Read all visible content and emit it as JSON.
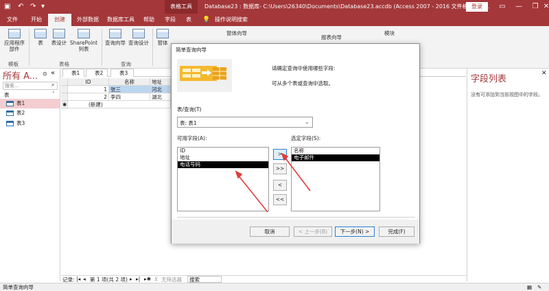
{
  "titlebar": {
    "context_tools": "表格工具",
    "doc_title": "Database23 : 数据库- C:\\Users\\26340\\Documents\\Database23.accdb (Access 2007 - 2016 文件格式) - A...",
    "login": "登录",
    "undo_icon": "undo-icon",
    "redo_icon": "redo-icon"
  },
  "tabs": [
    "文件",
    "开始",
    "创建",
    "外部数据",
    "数据库工具",
    "帮助",
    "字段",
    "表",
    "操作说明搜索"
  ],
  "ribbon": {
    "app_parts": "应用程序",
    "app_parts2": "部件",
    "table": "表",
    "table_design": "表设计",
    "sharepoint": "SharePoint",
    "sharepoint2": "列表",
    "query_wizard": "查询向导",
    "query_design": "查询设计",
    "window_abbr": "窗体",
    "form_wizard": "窗体向导",
    "report_wizard": "报表向导",
    "macro": "模块",
    "group_templates": "模板",
    "group_tables": "表格",
    "group_queries": "查询"
  },
  "nav": {
    "title": "所有 A...",
    "search_placeholder": "搜索...",
    "section": "表",
    "items": [
      "表1",
      "表2",
      "表3"
    ]
  },
  "doc_tabs": [
    "表1",
    "表2",
    "表3"
  ],
  "grid": {
    "headers": [
      "ID",
      "名称",
      "地址"
    ],
    "rows": [
      [
        "1",
        "张三",
        "河北"
      ],
      [
        "2",
        "李四",
        "湖北"
      ]
    ],
    "new_row": "(新建)"
  },
  "field_list": {
    "title": "字段列表",
    "message": "没有可添加到当前视图中的字段。"
  },
  "record_bar": {
    "label": "记录:",
    "position": "第 1 项(共 2 项)",
    "filter": "无筛选器",
    "search": "搜索"
  },
  "status_bar": "简单查询向导",
  "dialog": {
    "title": "简单查询向导",
    "prompt": "请确定查询中使用哪些字段:",
    "hint": "可从多个表或查询中选取。",
    "table_label": "表/查询(T)",
    "table_value": "表: 表1",
    "available_label": "可用字段(A):",
    "available_fields": [
      "ID",
      "地址",
      "电话号码"
    ],
    "available_selected": 2,
    "selected_label": "选定字段(S):",
    "selected_fields": [
      "名称",
      "电子邮件"
    ],
    "selected_selected": 1,
    "move_buttons": [
      ">",
      ">>",
      "<",
      "<<"
    ],
    "cancel": "取消",
    "back": "< 上一步(B)",
    "next": "下一步(N) >",
    "finish": "完成(F)"
  },
  "colors": {
    "brand": "#a4373a",
    "arrow": "#e03c3c"
  }
}
